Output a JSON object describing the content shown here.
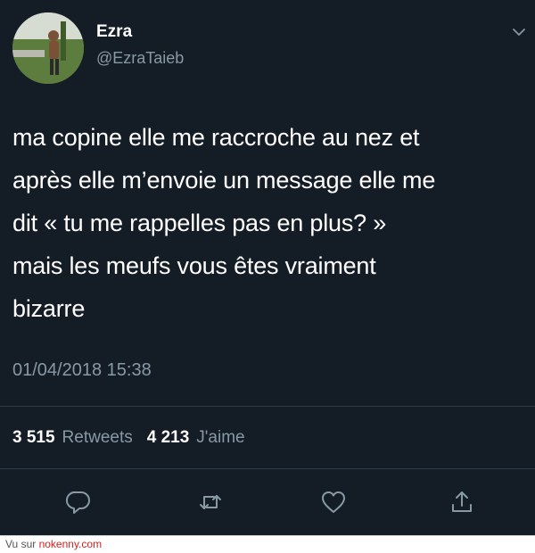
{
  "author": {
    "display_name": "Ezra",
    "handle": "@EzraTaieb"
  },
  "tweet": {
    "text": "ma copine elle me raccroche au nez et\naprès elle m’envoie un message elle me\ndit « tu me rappelles pas en plus? »\nmais les meufs vous êtes vraiment\nbizarre",
    "timestamp": "01/04/2018 15:38"
  },
  "stats": {
    "retweets_count": "3 515",
    "retweets_label": "Retweets",
    "likes_count": "4 213",
    "likes_label": "J'aime"
  },
  "footer": {
    "prefix": "Vu sur ",
    "site": "nokenny.com"
  },
  "colors": {
    "background": "#141d26",
    "secondary_text": "#8899a6",
    "footer_link": "#d42020"
  },
  "icons": [
    "chevron-down-icon",
    "reply-icon",
    "retweet-icon",
    "heart-icon",
    "share-icon"
  ]
}
